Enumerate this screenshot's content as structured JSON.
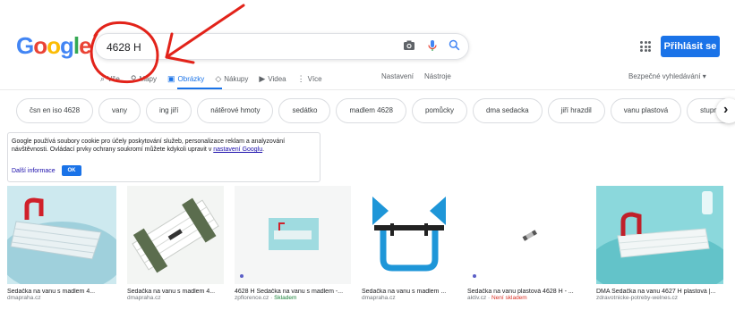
{
  "header": {
    "logo_letters": [
      "G",
      "o",
      "o",
      "g",
      "l",
      "e"
    ],
    "search_value": "4628 H",
    "signin_label": "Přihlásit se",
    "icons": {
      "camera": "camera-icon",
      "mic": "mic-icon",
      "search": "search-icon",
      "apps": "apps-grid-icon"
    }
  },
  "tabs": [
    {
      "label": "Vše",
      "icon": "search-icon"
    },
    {
      "label": "Mapy",
      "icon": "map-pin-icon"
    },
    {
      "label": "Obrázky",
      "icon": "image-icon",
      "active": true
    },
    {
      "label": "Nákupy",
      "icon": "tag-icon"
    },
    {
      "label": "Videa",
      "icon": "play-icon"
    },
    {
      "label": "Více",
      "icon": "more-vert-icon"
    }
  ],
  "tools": {
    "settings": "Nastavení",
    "tools": "Nástroje",
    "safesearch": "Bezpečné vyhledávání ▾"
  },
  "chips": [
    "čsn en iso 4628",
    "vany",
    "ing jiří",
    "nátěrové hmoty",
    "sedátko",
    "madlem 4628",
    "pomůcky",
    "dma sedacka",
    "jiří hrazdil",
    "vanu plastová",
    "stupně"
  ],
  "cookie": {
    "text_before_link": "Google používá soubory cookie pro účely poskytování služeb, personalizace reklam a analyzování návštěvnosti. Ovládací prvky ochrany soukromí můžete kdykoli upravit v ",
    "link": "nastavení Googlu",
    "text_after_link": ".",
    "more": "Další informace",
    "ok": "OK"
  },
  "results": [
    {
      "caption": "Sedačka na vanu s madlem 4...",
      "source": "dmapraha.cz",
      "status": ""
    },
    {
      "caption": "Sedačka na vanu s madlem 4...",
      "source": "dmapraha.cz",
      "status": ""
    },
    {
      "caption": "4628 H Sedačka na vanu s madlem -...",
      "source": "zpflorence.cz · ",
      "status": "Skladem"
    },
    {
      "caption": "Sedačka na vanu s madlem ...",
      "source": "dmapraha.cz",
      "status": ""
    },
    {
      "caption": "Sedačka na vanu plastová 4628 H - ...",
      "source": "aktiv.cz · ",
      "status": "Není skladem"
    },
    {
      "caption": "DMA Sedačka na vanu 4627 H plastová |...",
      "source": "zdravotnicke-potreby-welnes.cz",
      "status": ""
    }
  ],
  "colors": {
    "accent": "#1a73e8",
    "annotation": "#e2231a",
    "in_stock": "#188038",
    "out_of_stock": "#d93025"
  }
}
